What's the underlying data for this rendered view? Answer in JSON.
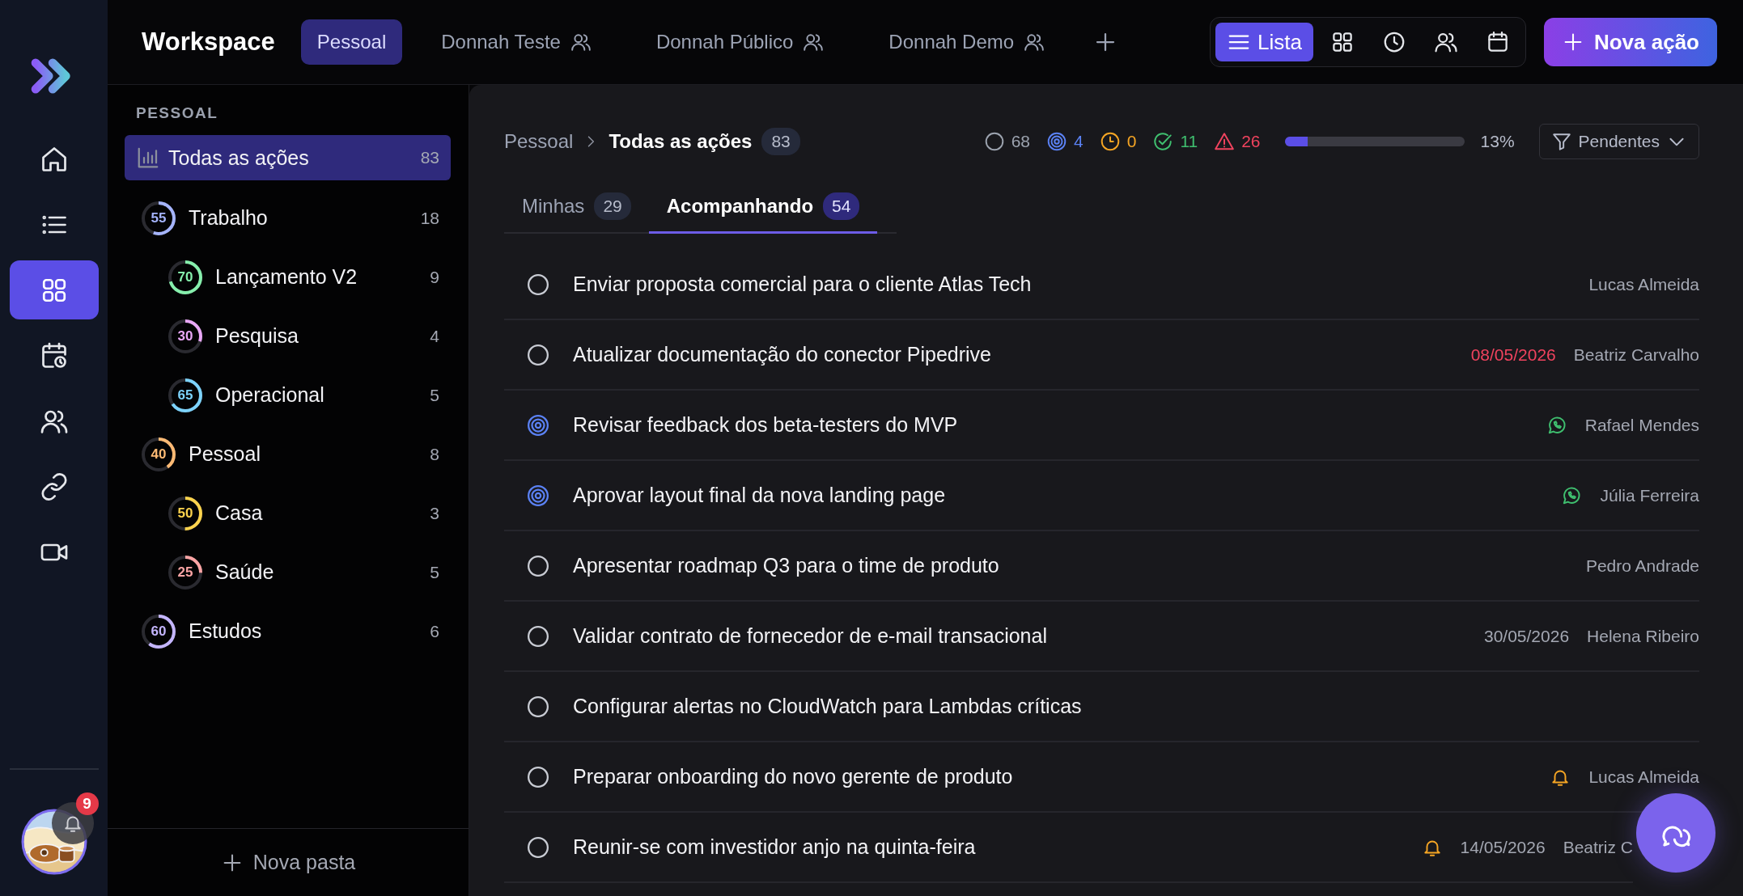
{
  "app_rail": {
    "items": [
      {
        "kind": "home",
        "selected": false
      },
      {
        "kind": "list",
        "selected": false
      },
      {
        "kind": "grid",
        "selected": true
      },
      {
        "kind": "calendar-clock",
        "selected": false
      },
      {
        "kind": "users",
        "selected": false
      },
      {
        "kind": "link",
        "selected": false
      },
      {
        "kind": "video",
        "selected": false
      }
    ],
    "notifications": {
      "count": "9"
    }
  },
  "topbar": {
    "title": "Workspace",
    "tabs": [
      {
        "label": "Pessoal",
        "selected": true,
        "shared": false
      },
      {
        "label": "Donnah Teste",
        "selected": false,
        "shared": true
      },
      {
        "label": "Donnah Público",
        "selected": false,
        "shared": true
      },
      {
        "label": "Donnah Demo",
        "selected": false,
        "shared": true
      }
    ],
    "views": [
      {
        "kind": "list",
        "label": "Lista",
        "selected": true
      },
      {
        "kind": "grid",
        "selected": false
      },
      {
        "kind": "clock",
        "selected": false
      },
      {
        "kind": "users",
        "selected": false
      },
      {
        "kind": "calendar",
        "selected": false
      }
    ],
    "new_button": "Nova ação"
  },
  "sidebar": {
    "section": "PESSOAL",
    "all": {
      "label": "Todas as ações",
      "count": "83",
      "selected": true
    },
    "folders": [
      {
        "name": "Trabalho",
        "percent": "55",
        "level": 0.55,
        "color": "#a5b4fc",
        "count": "18",
        "children": [
          {
            "name": "Lançamento V2",
            "percent": "70",
            "level": 0.7,
            "color": "#86efac",
            "count": "9"
          },
          {
            "name": "Pesquisa",
            "percent": "30",
            "level": 0.3,
            "color": "#e9a8f7",
            "count": "4"
          },
          {
            "name": "Operacional",
            "percent": "65",
            "level": 0.65,
            "color": "#7dd3fc",
            "count": "5"
          }
        ]
      },
      {
        "name": "Pessoal",
        "percent": "40",
        "level": 0.4,
        "color": "#fdba74",
        "count": "8",
        "children": [
          {
            "name": "Casa",
            "percent": "50",
            "level": 0.5,
            "color": "#fcd34d",
            "count": "3"
          },
          {
            "name": "Saúde",
            "percent": "25",
            "level": 0.25,
            "color": "#fca5a5",
            "count": "5"
          }
        ]
      },
      {
        "name": "Estudos",
        "percent": "60",
        "level": 0.6,
        "color": "#c4b5fd",
        "count": "6"
      }
    ],
    "new_folder": "Nova pasta"
  },
  "main": {
    "breadcrumb": {
      "parent": "Pessoal",
      "current": "Todas as ações",
      "count": "83"
    },
    "stats": [
      {
        "kind": "open",
        "count": "68",
        "color": "#9ca3af"
      },
      {
        "kind": "in_progress",
        "count": "4",
        "color": "#5b82f5"
      },
      {
        "kind": "waiting",
        "count": "0",
        "color": "#f5a524"
      },
      {
        "kind": "done",
        "count": "11",
        "color": "#3fbf6f"
      },
      {
        "kind": "overdue",
        "count": "26",
        "color": "#f0435e"
      }
    ],
    "progress": {
      "level": 0.13,
      "label": "13%"
    },
    "filter": "Pendentes",
    "tabs": [
      {
        "label": "Minhas",
        "count": "29",
        "selected": false
      },
      {
        "label": "Acompanhando",
        "count": "54",
        "selected": true
      }
    ],
    "tasks": [
      {
        "title": "Enviar proposta comercial para o cliente Atlas Tech",
        "in_progress": false,
        "whatsapp": false,
        "reminder": false,
        "assignee": "Lucas Almeida"
      },
      {
        "title": "Atualizar documentação do conector Pipedrive",
        "in_progress": false,
        "whatsapp": false,
        "reminder": false,
        "due": "08/05/2026",
        "overdue": true,
        "assignee": "Beatriz Carvalho"
      },
      {
        "title": "Revisar feedback dos beta-testers do MVP",
        "in_progress": true,
        "whatsapp": true,
        "reminder": false,
        "assignee": "Rafael Mendes"
      },
      {
        "title": "Aprovar layout final da nova landing page",
        "in_progress": true,
        "whatsapp": true,
        "reminder": false,
        "assignee": "Júlia Ferreira"
      },
      {
        "title": "Apresentar roadmap Q3 para o time de produto",
        "in_progress": false,
        "whatsapp": false,
        "reminder": false,
        "assignee": "Pedro Andrade"
      },
      {
        "title": "Validar contrato de fornecedor de e-mail transacional",
        "in_progress": false,
        "whatsapp": false,
        "reminder": false,
        "due": "30/05/2026",
        "overdue": false,
        "assignee": "Helena Ribeiro"
      },
      {
        "title": "Configurar alertas no CloudWatch para Lambdas críticas",
        "in_progress": false,
        "whatsapp": false,
        "reminder": false
      },
      {
        "title": "Preparar onboarding do novo gerente de produto",
        "in_progress": false,
        "whatsapp": false,
        "reminder": true,
        "assignee": "Lucas Almeida"
      },
      {
        "title": "Reunir-se com investidor anjo na quinta-feira",
        "in_progress": false,
        "whatsapp": false,
        "reminder": true,
        "due": "14/05/2026",
        "overdue": false,
        "assignee": "Beatriz C"
      }
    ]
  }
}
